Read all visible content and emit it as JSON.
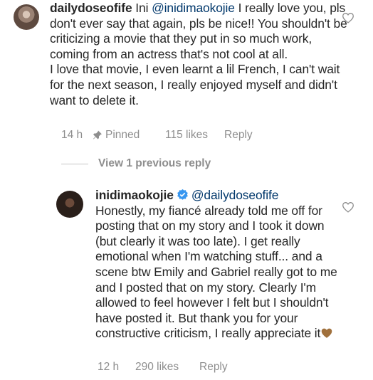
{
  "comment1": {
    "username": "dailydoseofife",
    "mention": "@inidimaokojie",
    "text_intro": "Ini",
    "text": " I really love you, pls don't ever say that again, pls be nice!! You shouldn't be criticizing a movie that they put in so much work, coming from an actress that's not cool at all.\nI love that movie, I even learnt a lil French, I can't wait for the next season, I really enjoyed myself and didn't want to delete it.",
    "time": "14 h",
    "pinned": "Pinned",
    "likes": "115 likes",
    "reply": "Reply"
  },
  "view_previous": "View 1 previous reply",
  "comment2": {
    "username": "inidimaokojie",
    "mention": "@dailydoseofife",
    "text": "Honestly, my fiancé already told me off for posting that on my story and I took it down (but clearly it was too late). I get really emotional when I'm watching stuff... and a scene btw Emily and Gabriel really got to me and I posted that on my story. Clearly I'm allowed to feel however I felt but I shouldn't have posted it. But thank you for your constructive criticism, I really appreciate it",
    "time": "12 h",
    "likes": "290 likes",
    "reply": "Reply"
  },
  "colors": {
    "mention": "#00376b",
    "meta": "#8e8e8e",
    "verified": "#3897f0",
    "emoji_heart": "#a0703c"
  },
  "icons": [
    "heart-outline-icon",
    "pin-icon",
    "verified-badge-icon",
    "brown-heart-emoji"
  ]
}
